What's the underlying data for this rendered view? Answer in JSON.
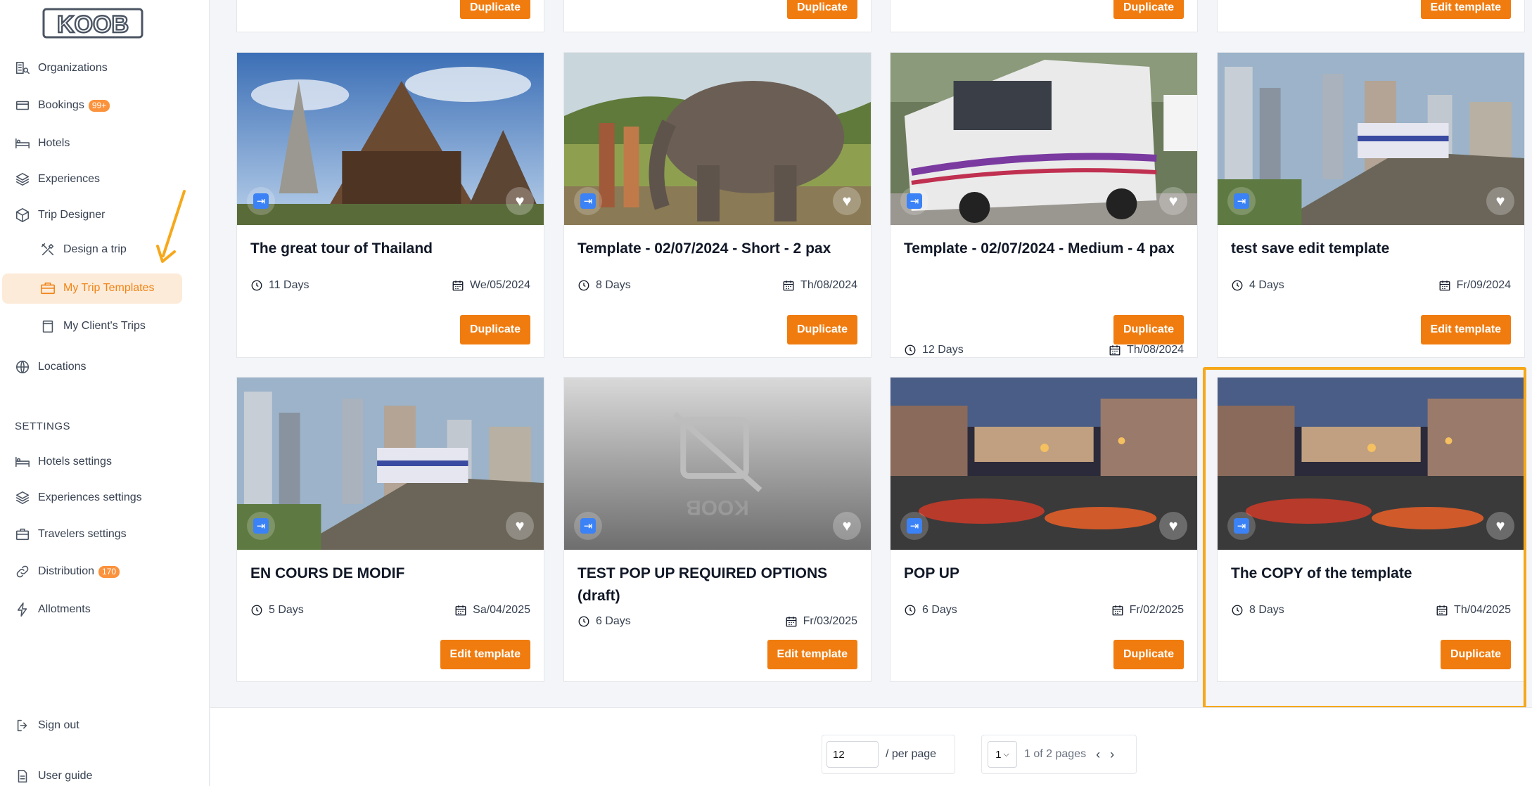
{
  "brand": {
    "logo_text": "KOOB"
  },
  "sidebar": {
    "items": [
      {
        "label": "Organizations",
        "icon": "organizations-icon"
      },
      {
        "label": "Bookings",
        "icon": "bookings-icon",
        "badge": "99+"
      },
      {
        "label": "Hotels",
        "icon": "bed-icon"
      },
      {
        "label": "Experiences",
        "icon": "layers-icon"
      },
      {
        "label": "Trip Designer",
        "icon": "cube-icon"
      },
      {
        "label": "Design a trip",
        "icon": "tools-icon"
      },
      {
        "label": "My Trip Templates",
        "icon": "briefcase-icon",
        "active": true
      },
      {
        "label": "My Client's Trips",
        "icon": "copy-icon"
      },
      {
        "label": "Locations",
        "icon": "globe-icon"
      }
    ],
    "settings_label": "SETTINGS",
    "settings_items": [
      {
        "label": "Hotels settings",
        "icon": "bed-icon"
      },
      {
        "label": "Experiences settings",
        "icon": "layers-icon"
      },
      {
        "label": "Travelers settings",
        "icon": "suitcase-icon"
      },
      {
        "label": "Distribution",
        "icon": "link-icon",
        "badge": "170"
      },
      {
        "label": "Allotments",
        "icon": "bolt-icon"
      }
    ],
    "bottom_items": [
      {
        "label": "Sign out",
        "icon": "sign-out-icon"
      },
      {
        "label": "User guide",
        "icon": "document-icon"
      }
    ]
  },
  "top_row_buttons": [
    "Duplicate",
    "Duplicate",
    "Duplicate",
    "Edit template"
  ],
  "cards": [
    {
      "title": "The great tour of Thailand",
      "days": "11 Days",
      "date": "We/05/2024",
      "action": "Duplicate",
      "image": "temple"
    },
    {
      "title": "Template - 02/07/2024 - Short - 2 pax",
      "days": "8 Days",
      "date": "Th/08/2024",
      "action": "Duplicate",
      "image": "elephant"
    },
    {
      "title": "Template - 02/07/2024 - Medium - 4 pax",
      "days": "12 Days",
      "date": "Th/08/2024",
      "action": "Duplicate",
      "image": "van"
    },
    {
      "title": "test save edit template",
      "days": "4 Days",
      "date": "Fr/09/2024",
      "action": "Edit template",
      "image": "city"
    },
    {
      "title": "EN COURS DE MODIF",
      "days": "5 Days",
      "date": "Sa/04/2025",
      "action": "Edit template",
      "image": "city"
    },
    {
      "title": "TEST POP UP REQUIRED OPTIONS (draft)",
      "days": "6 Days",
      "date": "Fr/03/2025",
      "action": "Edit template",
      "image": "placeholder"
    },
    {
      "title": "POP UP",
      "days": "6 Days",
      "date": "Fr/02/2025",
      "action": "Duplicate",
      "image": "market"
    },
    {
      "title": "The COPY of the template",
      "days": "8 Days",
      "date": "Th/04/2025",
      "action": "Duplicate",
      "image": "market",
      "highlighted": true
    }
  ],
  "pagination": {
    "per_page_value": "12",
    "per_page_label": "/ per page",
    "page_select": "1",
    "page_info": "1 of 2 pages"
  },
  "colors": {
    "accent": "#f07c10",
    "highlight": "#f6a81a",
    "active_bg": "#fdebd9"
  }
}
